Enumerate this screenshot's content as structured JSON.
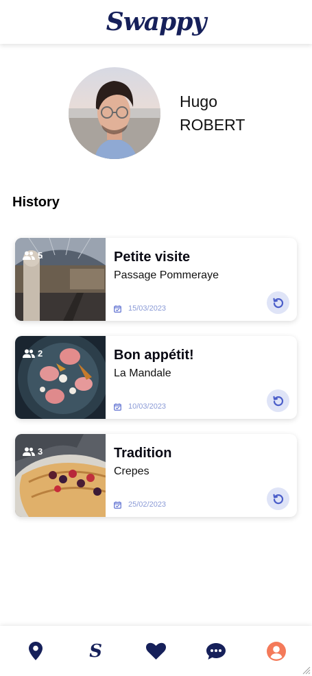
{
  "app": {
    "logo": "Swappy"
  },
  "profile": {
    "first_name": "Hugo",
    "last_name": "ROBERT"
  },
  "history": {
    "title": "History",
    "items": [
      {
        "title": "Petite visite",
        "place": "Passage Pommeraye",
        "people": "5",
        "date": "15/03/2023"
      },
      {
        "title": "Bon appétit!",
        "place": "La Mandale",
        "people": "2",
        "date": "10/03/2023"
      },
      {
        "title": "Tradition",
        "place": "Crepes",
        "people": "3",
        "date": "25/02/2023"
      }
    ]
  },
  "tabbar": {
    "items": [
      {
        "icon": "map-pin-icon"
      },
      {
        "icon": "swappy-s-icon",
        "label": "S"
      },
      {
        "icon": "heart-icon"
      },
      {
        "icon": "chat-bubble-icon"
      },
      {
        "icon": "user-icon",
        "active": true
      }
    ]
  },
  "colors": {
    "navy": "#16205a",
    "accent": "#f47a5a",
    "date": "#8a9ad6",
    "replay_bg": "#dfe4f7"
  }
}
